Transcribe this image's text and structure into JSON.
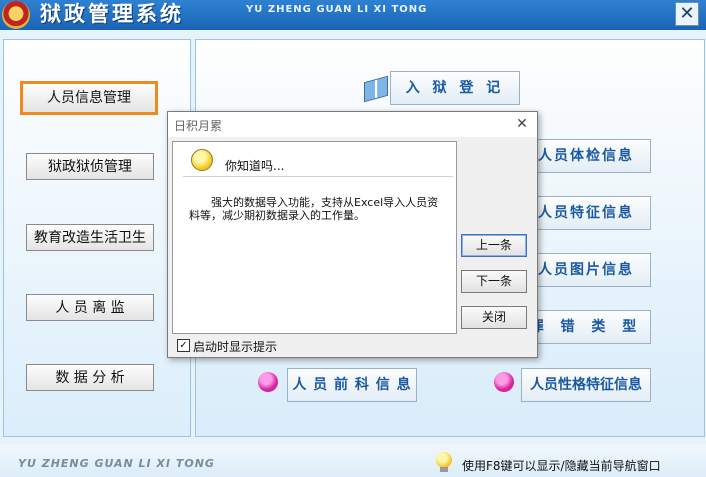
{
  "app": {
    "title": "狱政管理系统",
    "pinyin": "YU ZHENG GUAN LI XI TONG",
    "close_glyph": "✕"
  },
  "nav": {
    "items": [
      {
        "label": "人员信息管理",
        "active": true
      },
      {
        "label": "狱政狱侦管理"
      },
      {
        "label": "教育改造生活卫生"
      },
      {
        "label": "人 员 离 监"
      },
      {
        "label": "数 据 分 析"
      }
    ]
  },
  "modules": {
    "ruyu": "入 狱 登 记",
    "tijian": "人员体检信息",
    "tezheng": "人员特征信息",
    "tupian": "人员图片信息",
    "zuicuo": "罪 错 类 型",
    "qianke": "人 员 前 科 信 息",
    "xingge": "人员性格特征信息"
  },
  "footer": {
    "pinyin": "YU ZHENG GUAN LI XI TONG",
    "hint": "使用F8键可以显示/隐藏当前导航窗口"
  },
  "dialog": {
    "title": "日积月累",
    "close_glyph": "✕",
    "tip_heading": "你知道吗...",
    "tip_text": "强大的数据导入功能，支持从Excel导入人员资料等，减少期初数据录入的工作量。",
    "prev_button": "上一条",
    "next_button": "下一条",
    "close_button": "关闭",
    "checkbox_label": "启动时显示提示",
    "checkbox_checked": true,
    "check_glyph": "✓"
  },
  "icons": {
    "emblem": "police-emblem-icon",
    "book": "book-icon",
    "person": "person-icon",
    "bulb": "lightbulb-icon"
  },
  "colors": {
    "titlebar": "#1f6fc4",
    "active_border": "#f08a1e",
    "module_text": "#1b5aa0"
  }
}
